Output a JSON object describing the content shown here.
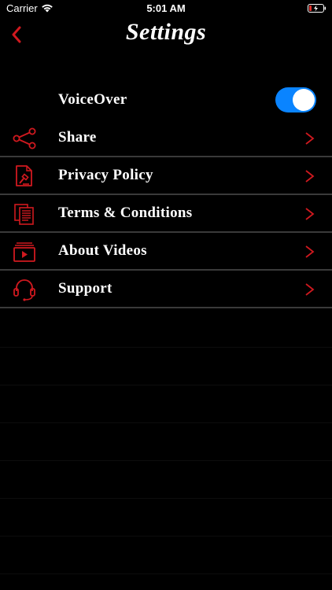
{
  "status_bar": {
    "carrier": "Carrier",
    "time": "5:01 AM",
    "icons": [
      "wifi-icon",
      "battery-charging-icon"
    ]
  },
  "nav": {
    "title": "Settings",
    "back_icon": "chevron-left-icon"
  },
  "settings": {
    "voiceover": {
      "label": "VoiceOver",
      "enabled": true
    },
    "items": [
      {
        "label": "Share",
        "icon": "share-icon"
      },
      {
        "label": "Privacy Policy",
        "icon": "privacy-document-icon"
      },
      {
        "label": "Terms & Conditions",
        "icon": "documents-icon"
      },
      {
        "label": "About Videos",
        "icon": "video-icon"
      },
      {
        "label": "Support",
        "icon": "headset-icon"
      }
    ]
  },
  "colors": {
    "accent": "#d0191f",
    "toggle_on": "#0a84ff",
    "background": "#000000",
    "separator": "#3a3a3a"
  }
}
